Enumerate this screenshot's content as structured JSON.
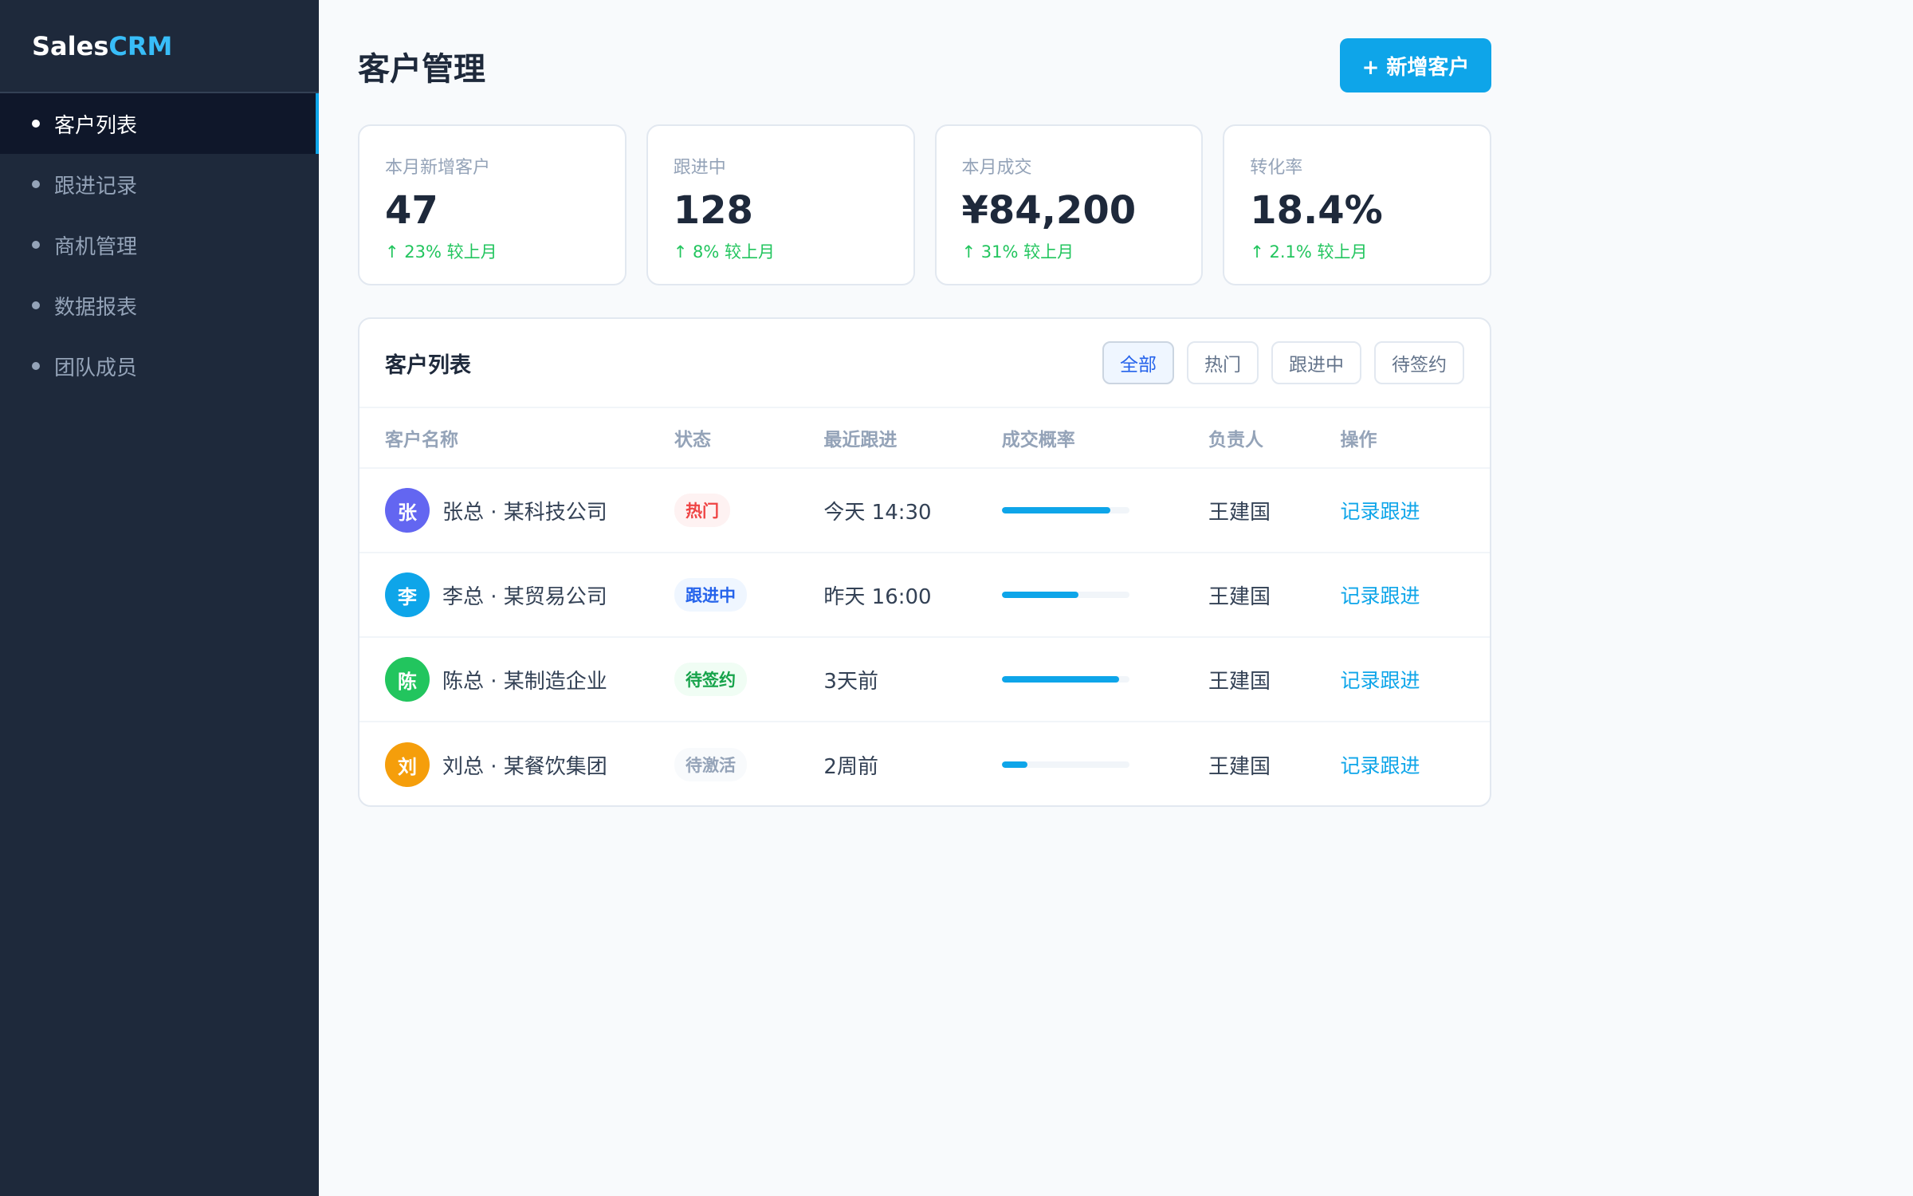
{
  "brand": {
    "part1": "Sales",
    "part2": "CRM"
  },
  "sidebar": {
    "items": [
      {
        "label": "客户列表",
        "active": true
      },
      {
        "label": "跟进记录",
        "active": false
      },
      {
        "label": "商机管理",
        "active": false
      },
      {
        "label": "数据报表",
        "active": false
      },
      {
        "label": "团队成员",
        "active": false
      }
    ]
  },
  "header": {
    "title": "客户管理",
    "add_button": "+ 新增客户"
  },
  "stats": [
    {
      "label": "本月新增客户",
      "value": "47",
      "delta": "↑ 23% 较上月"
    },
    {
      "label": "跟进中",
      "value": "128",
      "delta": "↑ 8% 较上月"
    },
    {
      "label": "本月成交",
      "value": "¥84,200",
      "delta": "↑ 31% 较上月"
    },
    {
      "label": "转化率",
      "value": "18.4%",
      "delta": "↑ 2.1% 较上月"
    }
  ],
  "table": {
    "title": "客户列表",
    "filters": [
      {
        "label": "全部",
        "active": true
      },
      {
        "label": "热门",
        "active": false
      },
      {
        "label": "跟进中",
        "active": false
      },
      {
        "label": "待签约",
        "active": false
      }
    ],
    "columns": [
      "客户名称",
      "状态",
      "最近跟进",
      "成交概率",
      "负责人",
      "操作"
    ],
    "rows": [
      {
        "avatar": "张",
        "avatar_color": "#6366f1",
        "name": "张总 · 某科技公司",
        "status": "热门",
        "status_fg": "#ef4444",
        "status_bg": "#fef2f2",
        "last_follow": "今天 14:30",
        "probability": 0.85,
        "owner": "王建国",
        "action": "记录跟进"
      },
      {
        "avatar": "李",
        "avatar_color": "#0ea5e9",
        "name": "李总 · 某贸易公司",
        "status": "跟进中",
        "status_fg": "#2563eb",
        "status_bg": "#eff6ff",
        "last_follow": "昨天 16:00",
        "probability": 0.6,
        "owner": "王建国",
        "action": "记录跟进"
      },
      {
        "avatar": "陈",
        "avatar_color": "#22c55e",
        "name": "陈总 · 某制造企业",
        "status": "待签约",
        "status_fg": "#16a34a",
        "status_bg": "#f0fdf4",
        "last_follow": "3天前",
        "probability": 0.92,
        "owner": "王建国",
        "action": "记录跟进"
      },
      {
        "avatar": "刘",
        "avatar_color": "#f59e0b",
        "name": "刘总 · 某餐饮集团",
        "status": "待激活",
        "status_fg": "#94a3b8",
        "status_bg": "#f8fafc",
        "last_follow": "2周前",
        "probability": 0.2,
        "owner": "王建国",
        "action": "记录跟进"
      }
    ]
  }
}
